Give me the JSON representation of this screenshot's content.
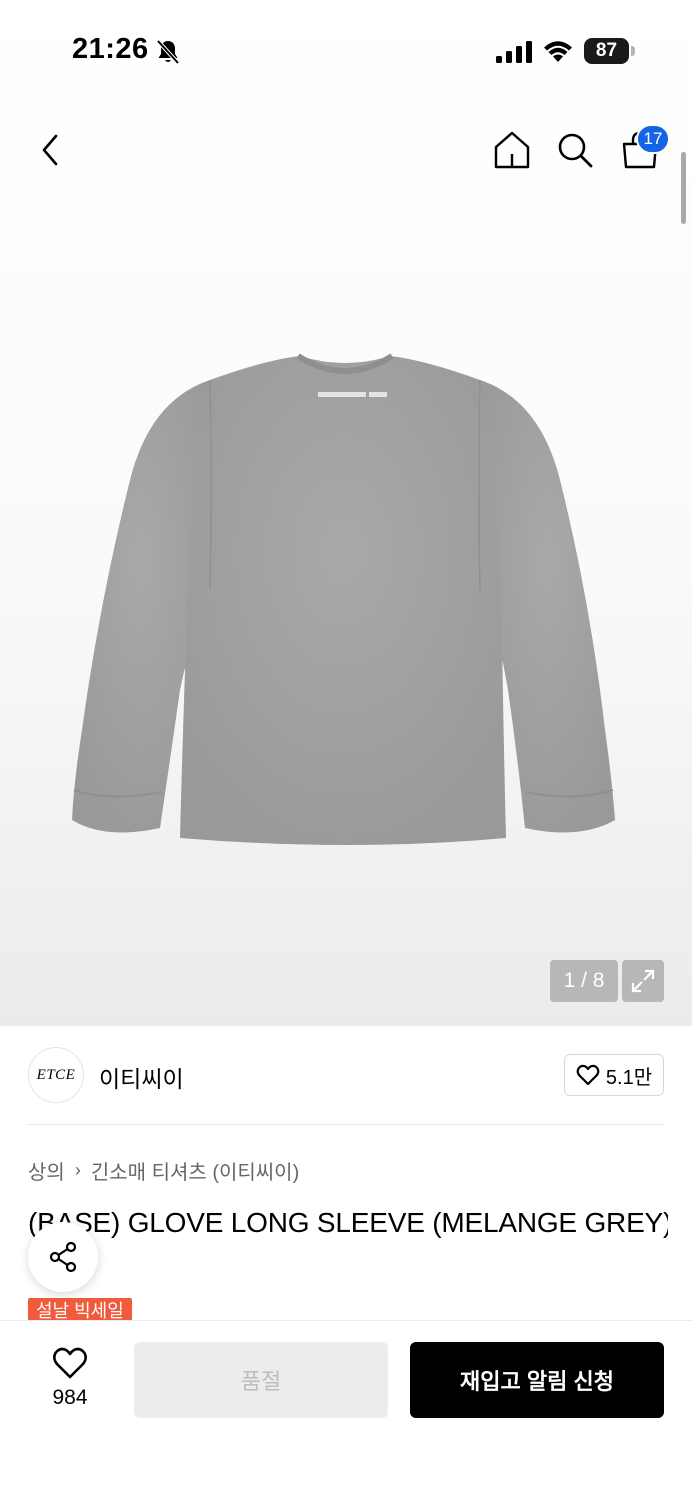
{
  "status_bar": {
    "time": "21:26",
    "battery": "87",
    "icons": [
      "bell-off-icon",
      "signal-icon",
      "wifi-icon",
      "battery-icon"
    ]
  },
  "nav": {
    "cart_count": "17",
    "icons": [
      "back-icon",
      "home-icon",
      "search-icon",
      "cart-icon"
    ]
  },
  "gallery": {
    "counter": "1 / 8",
    "current_index": 1,
    "total": 8
  },
  "brand": {
    "logo_text": "ETCE",
    "name": "이티씨이",
    "like_count": "5.1만"
  },
  "breadcrumb": {
    "items": [
      "상의",
      "긴소매 티셔츠 (이티씨이)"
    ]
  },
  "product": {
    "title": "(BASE) GLOVE LONG SLEEVE (MELANGE GREY)",
    "badge": "설날 빅세일"
  },
  "bottom_bar": {
    "wish_count": "984",
    "soldout_label": "품절",
    "restock_label": "재입고 알림 신청"
  },
  "colors": {
    "accent_blue": "#1464e8",
    "sale_orange": "#f25a3c",
    "product_grey": "#a3a3a3"
  }
}
